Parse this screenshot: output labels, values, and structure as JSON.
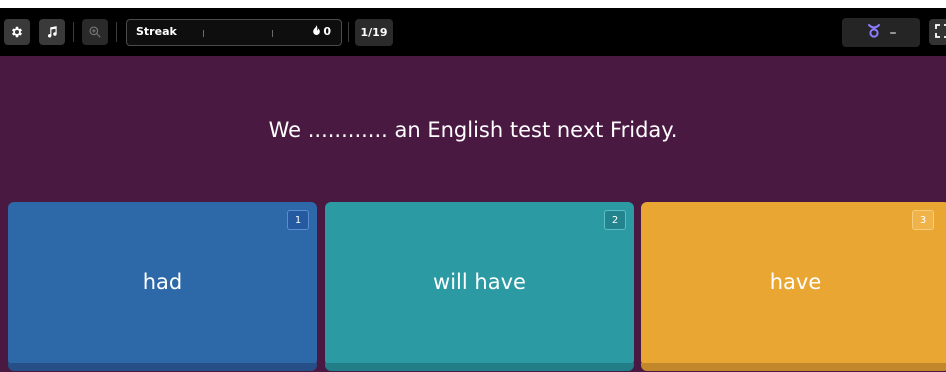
{
  "toolbar": {
    "settings_icon": "gear-icon",
    "music_icon": "music-note-icon",
    "zoom_icon": "zoom-in-icon",
    "streak_label": "Streak",
    "streak_icon": "flame-icon",
    "streak_count": "0",
    "progress": "1/19",
    "powerup_icon": "powerup-icon",
    "powerup_value": "–",
    "fullscreen_icon": "fullscreen-icon"
  },
  "question": {
    "text": "We ............ an English test next Friday."
  },
  "options": [
    {
      "label": "had",
      "key": "1",
      "color": "#2d69a8",
      "key_bg": "#2559a0",
      "shadow": "#254f86"
    },
    {
      "label": "will have",
      "key": "2",
      "color": "#2b9aa3",
      "key_bg": "#24848d",
      "shadow": "#217d86"
    },
    {
      "label": "have",
      "key": "3",
      "color": "#eaa633",
      "key_bg": "#efb349",
      "shadow": "#c2872a"
    }
  ],
  "colors": {
    "question_background": "#4a1942",
    "toolbar_background": "#000000",
    "powerup_accent": "#8c7dff"
  }
}
